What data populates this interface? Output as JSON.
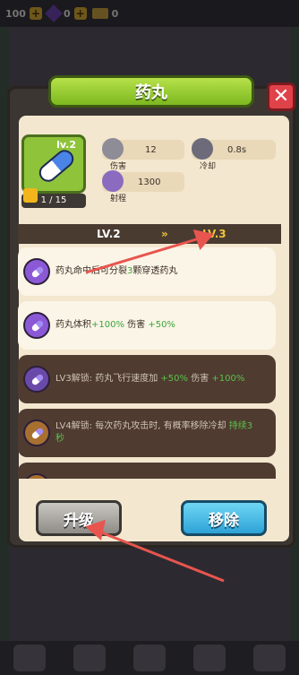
{
  "top_bar": {
    "coins": "100",
    "gems": "0",
    "tickets": "0"
  },
  "dialog": {
    "title": "药丸",
    "close_label": "✕"
  },
  "item": {
    "level": "lv.2",
    "shards": "1 / 15",
    "stats": [
      {
        "icon": "sword-icon",
        "label": "伤害",
        "value": "12"
      },
      {
        "icon": "clock-icon",
        "label": "冷却",
        "value": "0.8s"
      },
      {
        "icon": "bow-icon",
        "label": "射程",
        "value": "1300"
      }
    ]
  },
  "level_header": {
    "current": "LV.2",
    "arrow": "»",
    "next": "LV.3"
  },
  "upgrades": [
    {
      "text": "药丸命中后可分裂",
      "highlight": "3",
      "text2": "颗穿透药丸",
      "style": "light",
      "icon_color": "#8b59d6"
    },
    {
      "text": "药丸体积",
      "highlight": "+100%",
      "text2": " 伤害 ",
      "highlight2": "+50%",
      "style": "light",
      "icon_color": "#8b59d6"
    },
    {
      "text": "LV3解锁: 药丸飞行速度加 ",
      "highlight": "+50%",
      "text2": " 伤害 ",
      "highlight2": "+100%",
      "style": "dark",
      "icon_color": "#6a4aa8"
    },
    {
      "text": "LV4解锁: 每次药丸攻击时, 有概率移除冷却",
      "highlight": " 持续3秒",
      "style": "dark",
      "icon_color": "#a8702f"
    }
  ],
  "buttons": {
    "upgrade": "升级",
    "remove": "移除"
  },
  "colors": {
    "title_green": "#8fc43a",
    "remove_blue": "#2da2d6",
    "highlight_green": "#3ca33a",
    "close_red": "#e0424a"
  }
}
